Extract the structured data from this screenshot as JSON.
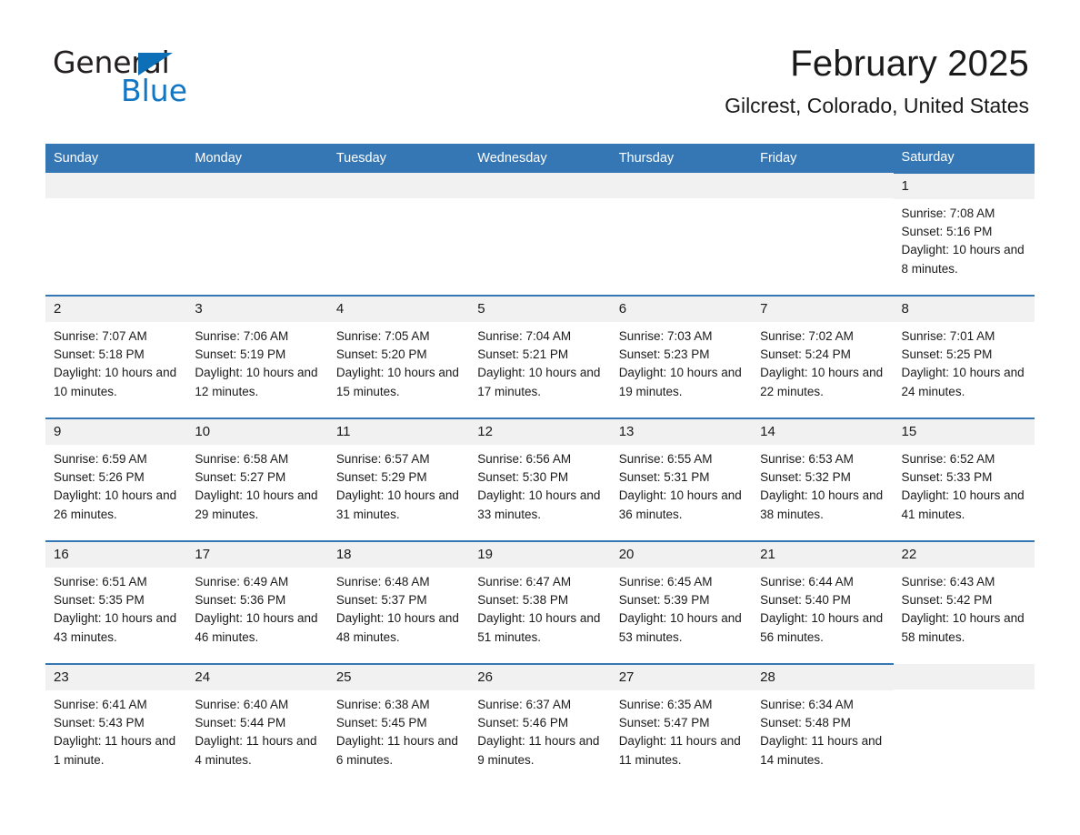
{
  "logo": {
    "word_one": "General",
    "word_two": "Blue",
    "triangle_icon": "triangle-icon",
    "brand_blue": "#1176c4"
  },
  "header": {
    "month_title": "February 2025",
    "location": "Gilcrest, Colorado, United States"
  },
  "calendar": {
    "header_bg": "#3576b4",
    "daynum_bg": "#f1f1f1",
    "weekdays": [
      "Sunday",
      "Monday",
      "Tuesday",
      "Wednesday",
      "Thursday",
      "Friday",
      "Saturday"
    ],
    "weeks": [
      [
        {
          "day": "",
          "empty": true
        },
        {
          "day": "",
          "empty": true
        },
        {
          "day": "",
          "empty": true
        },
        {
          "day": "",
          "empty": true
        },
        {
          "day": "",
          "empty": true
        },
        {
          "day": "",
          "empty": true
        },
        {
          "day": "1",
          "sunrise": "Sunrise: 7:08 AM",
          "sunset": "Sunset: 5:16 PM",
          "daylight": "Daylight: 10 hours and 8 minutes."
        }
      ],
      [
        {
          "day": "2",
          "sunrise": "Sunrise: 7:07 AM",
          "sunset": "Sunset: 5:18 PM",
          "daylight": "Daylight: 10 hours and 10 minutes."
        },
        {
          "day": "3",
          "sunrise": "Sunrise: 7:06 AM",
          "sunset": "Sunset: 5:19 PM",
          "daylight": "Daylight: 10 hours and 12 minutes."
        },
        {
          "day": "4",
          "sunrise": "Sunrise: 7:05 AM",
          "sunset": "Sunset: 5:20 PM",
          "daylight": "Daylight: 10 hours and 15 minutes."
        },
        {
          "day": "5",
          "sunrise": "Sunrise: 7:04 AM",
          "sunset": "Sunset: 5:21 PM",
          "daylight": "Daylight: 10 hours and 17 minutes."
        },
        {
          "day": "6",
          "sunrise": "Sunrise: 7:03 AM",
          "sunset": "Sunset: 5:23 PM",
          "daylight": "Daylight: 10 hours and 19 minutes."
        },
        {
          "day": "7",
          "sunrise": "Sunrise: 7:02 AM",
          "sunset": "Sunset: 5:24 PM",
          "daylight": "Daylight: 10 hours and 22 minutes."
        },
        {
          "day": "8",
          "sunrise": "Sunrise: 7:01 AM",
          "sunset": "Sunset: 5:25 PM",
          "daylight": "Daylight: 10 hours and 24 minutes."
        }
      ],
      [
        {
          "day": "9",
          "sunrise": "Sunrise: 6:59 AM",
          "sunset": "Sunset: 5:26 PM",
          "daylight": "Daylight: 10 hours and 26 minutes."
        },
        {
          "day": "10",
          "sunrise": "Sunrise: 6:58 AM",
          "sunset": "Sunset: 5:27 PM",
          "daylight": "Daylight: 10 hours and 29 minutes."
        },
        {
          "day": "11",
          "sunrise": "Sunrise: 6:57 AM",
          "sunset": "Sunset: 5:29 PM",
          "daylight": "Daylight: 10 hours and 31 minutes."
        },
        {
          "day": "12",
          "sunrise": "Sunrise: 6:56 AM",
          "sunset": "Sunset: 5:30 PM",
          "daylight": "Daylight: 10 hours and 33 minutes."
        },
        {
          "day": "13",
          "sunrise": "Sunrise: 6:55 AM",
          "sunset": "Sunset: 5:31 PM",
          "daylight": "Daylight: 10 hours and 36 minutes."
        },
        {
          "day": "14",
          "sunrise": "Sunrise: 6:53 AM",
          "sunset": "Sunset: 5:32 PM",
          "daylight": "Daylight: 10 hours and 38 minutes."
        },
        {
          "day": "15",
          "sunrise": "Sunrise: 6:52 AM",
          "sunset": "Sunset: 5:33 PM",
          "daylight": "Daylight: 10 hours and 41 minutes."
        }
      ],
      [
        {
          "day": "16",
          "sunrise": "Sunrise: 6:51 AM",
          "sunset": "Sunset: 5:35 PM",
          "daylight": "Daylight: 10 hours and 43 minutes."
        },
        {
          "day": "17",
          "sunrise": "Sunrise: 6:49 AM",
          "sunset": "Sunset: 5:36 PM",
          "daylight": "Daylight: 10 hours and 46 minutes."
        },
        {
          "day": "18",
          "sunrise": "Sunrise: 6:48 AM",
          "sunset": "Sunset: 5:37 PM",
          "daylight": "Daylight: 10 hours and 48 minutes."
        },
        {
          "day": "19",
          "sunrise": "Sunrise: 6:47 AM",
          "sunset": "Sunset: 5:38 PM",
          "daylight": "Daylight: 10 hours and 51 minutes."
        },
        {
          "day": "20",
          "sunrise": "Sunrise: 6:45 AM",
          "sunset": "Sunset: 5:39 PM",
          "daylight": "Daylight: 10 hours and 53 minutes."
        },
        {
          "day": "21",
          "sunrise": "Sunrise: 6:44 AM",
          "sunset": "Sunset: 5:40 PM",
          "daylight": "Daylight: 10 hours and 56 minutes."
        },
        {
          "day": "22",
          "sunrise": "Sunrise: 6:43 AM",
          "sunset": "Sunset: 5:42 PM",
          "daylight": "Daylight: 10 hours and 58 minutes."
        }
      ],
      [
        {
          "day": "23",
          "sunrise": "Sunrise: 6:41 AM",
          "sunset": "Sunset: 5:43 PM",
          "daylight": "Daylight: 11 hours and 1 minute."
        },
        {
          "day": "24",
          "sunrise": "Sunrise: 6:40 AM",
          "sunset": "Sunset: 5:44 PM",
          "daylight": "Daylight: 11 hours and 4 minutes."
        },
        {
          "day": "25",
          "sunrise": "Sunrise: 6:38 AM",
          "sunset": "Sunset: 5:45 PM",
          "daylight": "Daylight: 11 hours and 6 minutes."
        },
        {
          "day": "26",
          "sunrise": "Sunrise: 6:37 AM",
          "sunset": "Sunset: 5:46 PM",
          "daylight": "Daylight: 11 hours and 9 minutes."
        },
        {
          "day": "27",
          "sunrise": "Sunrise: 6:35 AM",
          "sunset": "Sunset: 5:47 PM",
          "daylight": "Daylight: 11 hours and 11 minutes."
        },
        {
          "day": "28",
          "sunrise": "Sunrise: 6:34 AM",
          "sunset": "Sunset: 5:48 PM",
          "daylight": "Daylight: 11 hours and 14 minutes."
        },
        {
          "day": "",
          "empty": true
        }
      ]
    ]
  }
}
